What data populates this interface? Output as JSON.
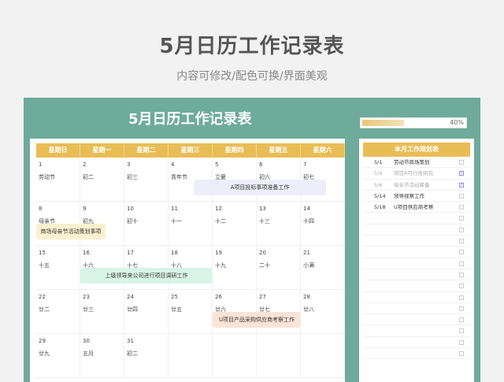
{
  "header": {
    "title": "5月日历工作记录表",
    "subtitle": "内容可修改/配色可换/界面美观"
  },
  "frame": {
    "title": "5月日历工作记录表",
    "progress_label": "40%",
    "progress_value": 0.4
  },
  "calendar": {
    "weekdays": [
      "星期日",
      "星期一",
      "星期二",
      "星期三",
      "星期四",
      "星期五",
      "星期六"
    ],
    "weeks": [
      [
        {
          "n": "1",
          "l": "劳动节"
        },
        {
          "n": "2",
          "l": "初二"
        },
        {
          "n": "3",
          "l": "初三"
        },
        {
          "n": "4",
          "l": "青年节"
        },
        {
          "n": "5",
          "l": "立夏"
        },
        {
          "n": "6",
          "l": "初六"
        },
        {
          "n": "7",
          "l": "初七"
        }
      ],
      [
        {
          "n": "8",
          "l": "母亲节"
        },
        {
          "n": "9",
          "l": "初九"
        },
        {
          "n": "10",
          "l": "初十"
        },
        {
          "n": "11",
          "l": "十一"
        },
        {
          "n": "12",
          "l": "十二"
        },
        {
          "n": "13",
          "l": "十三"
        },
        {
          "n": "14",
          "l": "十四"
        }
      ],
      [
        {
          "n": "15",
          "l": "十五"
        },
        {
          "n": "16",
          "l": "十六"
        },
        {
          "n": "17",
          "l": "十七"
        },
        {
          "n": "18",
          "l": "十八"
        },
        {
          "n": "19",
          "l": "十九"
        },
        {
          "n": "20",
          "l": "二十"
        },
        {
          "n": "21",
          "l": "小满"
        }
      ],
      [
        {
          "n": "22",
          "l": "廿二"
        },
        {
          "n": "23",
          "l": "廿三"
        },
        {
          "n": "24",
          "l": "廿四"
        },
        {
          "n": "25",
          "l": "廿五"
        },
        {
          "n": "26",
          "l": "廿六"
        },
        {
          "n": "27",
          "l": "廿七"
        },
        {
          "n": "28",
          "l": "廿八"
        }
      ],
      [
        {
          "n": "29",
          "l": "廿九"
        },
        {
          "n": "30",
          "l": "五月"
        },
        {
          "n": "31",
          "l": "初二"
        },
        {
          "n": "",
          "l": ""
        },
        {
          "n": "",
          "l": ""
        },
        {
          "n": "",
          "l": ""
        },
        {
          "n": "",
          "l": ""
        }
      ]
    ],
    "events": [
      {
        "text": "A项目投标事项准备工作",
        "color": "#eeeefa"
      },
      {
        "text": "商场母亲节活动策划事项",
        "color": "#fdf0cf"
      },
      {
        "text": "上级领导来公司进行项目调研工作",
        "color": "#d9f5e7"
      },
      {
        "text": "U项目产品采购供应商考察工作",
        "color": "#fbe4d7"
      }
    ]
  },
  "plan": {
    "title": "本月工作规划表",
    "items": [
      {
        "date": "5/1",
        "text": "劳动节商场策划",
        "done": false
      },
      {
        "date": "5/9",
        "text": "项目A可行性研究",
        "done": true
      },
      {
        "date": "5/6",
        "text": "母亲节活动筹备",
        "done": true
      },
      {
        "date": "5/14",
        "text": "领导视察工作",
        "done": false
      },
      {
        "date": "5/18",
        "text": "U项目供应商考察",
        "done": false
      },
      {
        "date": "",
        "text": "",
        "done": false
      },
      {
        "date": "",
        "text": "",
        "done": false
      },
      {
        "date": "",
        "text": "",
        "done": false
      },
      {
        "date": "",
        "text": "",
        "done": false
      },
      {
        "date": "",
        "text": "",
        "done": false
      },
      {
        "date": "",
        "text": "",
        "done": false
      },
      {
        "date": "",
        "text": "",
        "done": false
      },
      {
        "date": "",
        "text": "",
        "done": false
      },
      {
        "date": "",
        "text": "",
        "done": false
      },
      {
        "date": "",
        "text": "",
        "done": false
      },
      {
        "date": "",
        "text": "",
        "done": false
      },
      {
        "date": "",
        "text": "",
        "done": false
      },
      {
        "date": "",
        "text": "",
        "done": false
      }
    ]
  }
}
